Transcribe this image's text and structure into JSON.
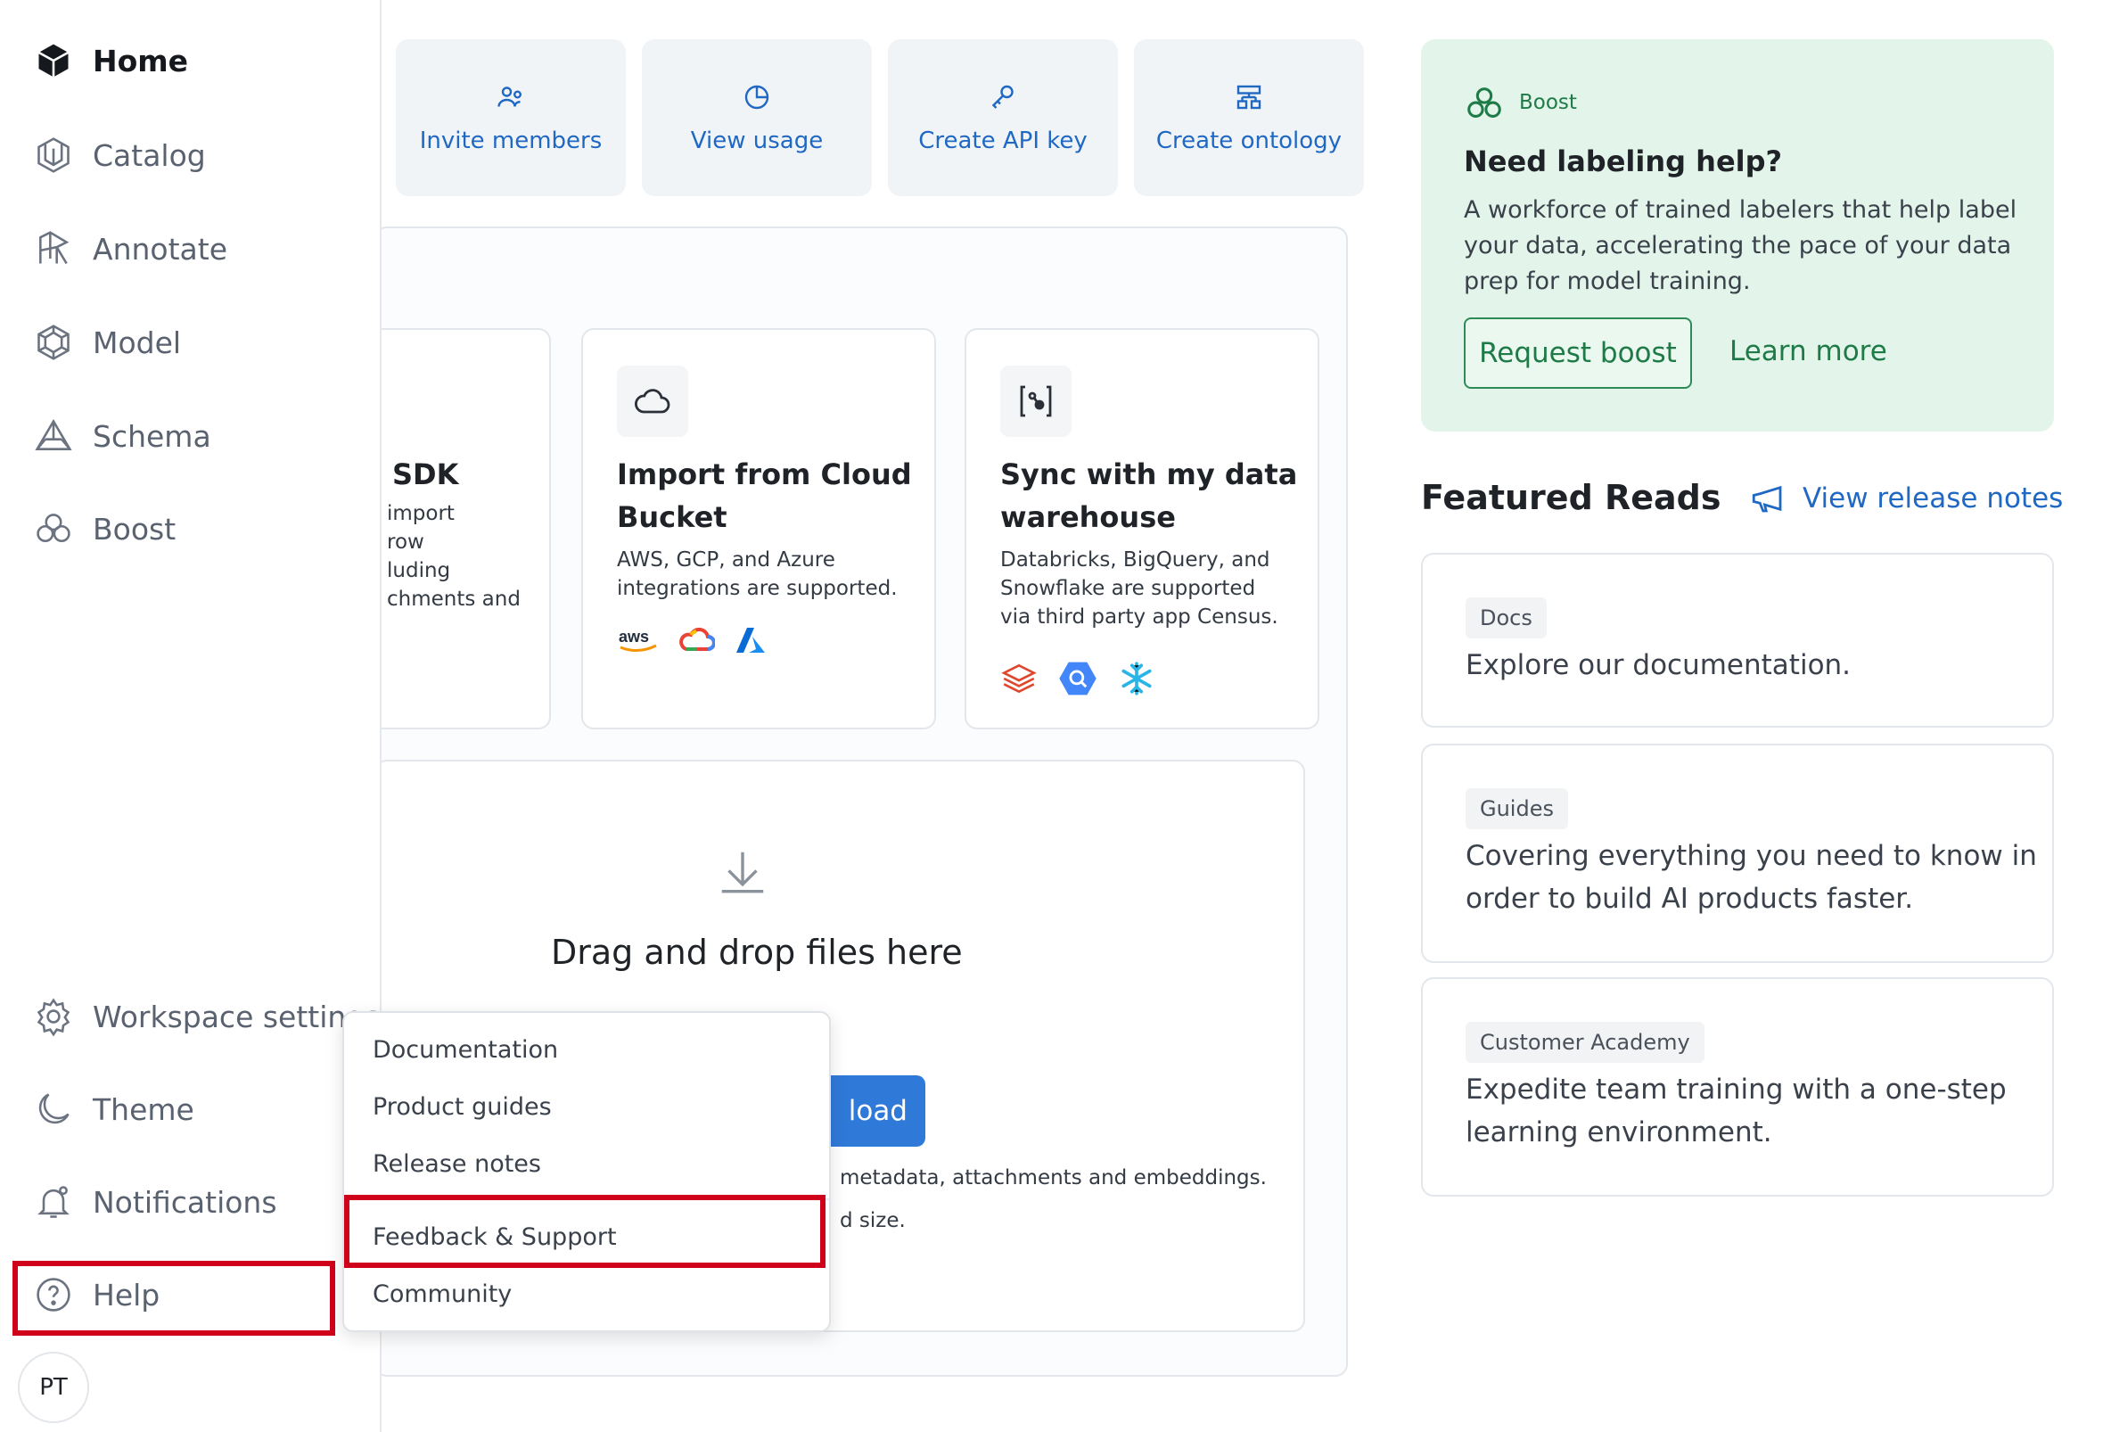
{
  "sidebar": {
    "top_items": [
      {
        "label": "Home",
        "icon": "home-icon"
      },
      {
        "label": "Catalog",
        "icon": "catalog-icon"
      },
      {
        "label": "Annotate",
        "icon": "annotate-icon"
      },
      {
        "label": "Model",
        "icon": "model-icon"
      },
      {
        "label": "Schema",
        "icon": "schema-icon"
      },
      {
        "label": "Boost",
        "icon": "boost-icon"
      }
    ],
    "bottom_items": [
      {
        "label": "Workspace settings",
        "icon": "gear-icon"
      },
      {
        "label": "Theme",
        "icon": "moon-icon"
      },
      {
        "label": "Notifications",
        "icon": "bell-icon"
      },
      {
        "label": "Help",
        "icon": "help-icon"
      }
    ],
    "avatar_initials": "PT"
  },
  "quick_actions": [
    {
      "label": "Invite members",
      "icon": "users-icon"
    },
    {
      "label": "View usage",
      "icon": "pie-chart-icon"
    },
    {
      "label": "Create API key",
      "icon": "key-icon"
    },
    {
      "label": "Create ontology",
      "icon": "ontology-icon"
    }
  ],
  "import_cards": {
    "sdk": {
      "title": "SDK",
      "lines": [
        "import",
        "row",
        "luding",
        "chments and"
      ]
    },
    "cloud": {
      "title_1": "Import from Cloud",
      "title_2": "Bucket",
      "desc_1": "AWS, GCP, and Azure",
      "desc_2": "integrations are supported.",
      "logos": [
        "aws",
        "gcp",
        "azure"
      ]
    },
    "warehouse": {
      "title_1": "Sync with my data",
      "title_2": "warehouse",
      "desc_1": "Databricks, BigQuery, and",
      "desc_2": "Snowflake are supported",
      "desc_3": "via third party app Census.",
      "logos": [
        "databricks",
        "bigquery",
        "snowflake"
      ]
    }
  },
  "dropzone": {
    "title": "Drag and drop files here",
    "upload_label": "load",
    "note_1": "metadata, attachments and embeddings.",
    "note_2": "d size."
  },
  "help_menu": {
    "items": [
      "Documentation",
      "Product guides",
      "Release notes",
      "Feedback & Support",
      "Community"
    ]
  },
  "boost": {
    "tag": "Boost",
    "title": "Need labeling help?",
    "desc_1": "A workforce of trained labelers that help label",
    "desc_2": "your data, accelerating the pace of your data",
    "desc_3": "prep for model training.",
    "request_label": "Request boost",
    "learn_label": "Learn more"
  },
  "featured": {
    "heading": "Featured Reads",
    "release_notes_label": "View release notes",
    "reads": [
      {
        "tag": "Docs",
        "line_1": "Explore our documentation.",
        "line_2": ""
      },
      {
        "tag": "Guides",
        "line_1": "Covering everything you need to know in",
        "line_2": "order to build AI products faster."
      },
      {
        "tag": "Customer Academy",
        "line_1": "Expedite team training with a one-step",
        "line_2": "learning environment."
      }
    ]
  },
  "colors": {
    "accent": "#1f68c4",
    "boost_bg": "#e3f5ea",
    "boost_green": "#1e7a46",
    "highlight": "#d0021b"
  }
}
